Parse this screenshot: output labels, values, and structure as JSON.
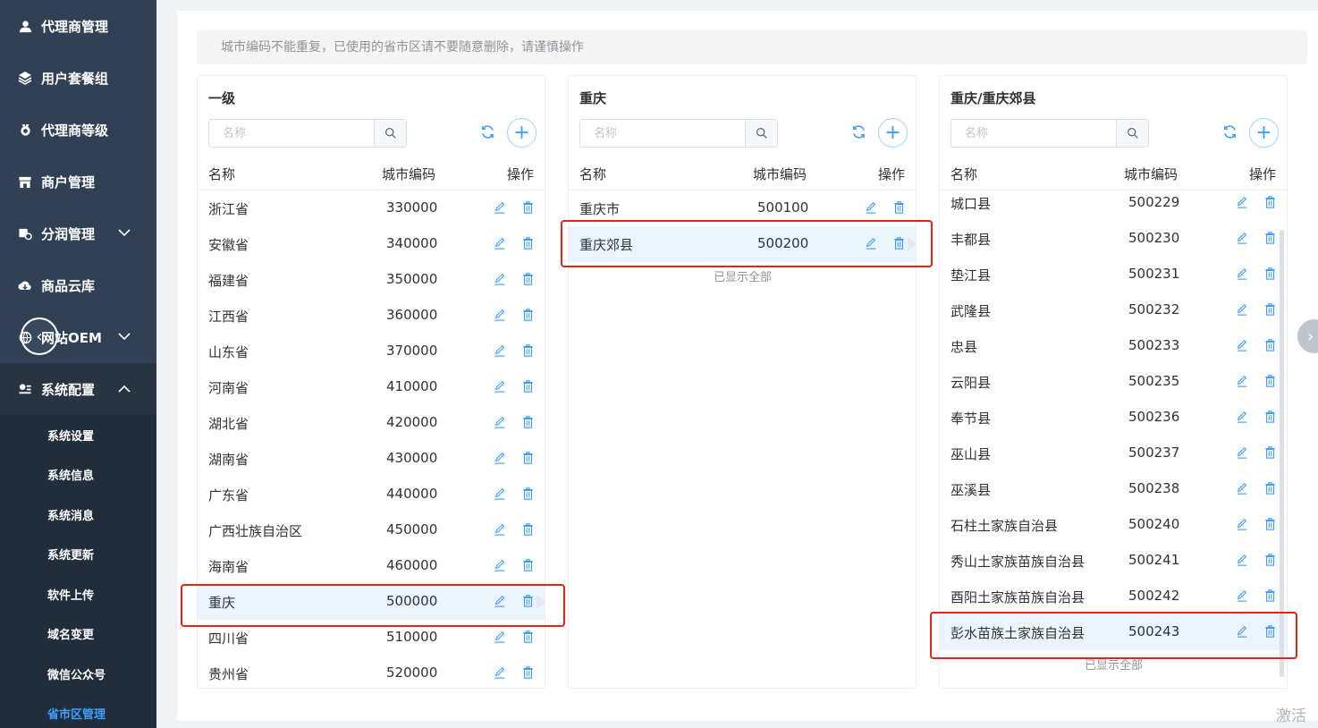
{
  "sidebar": {
    "menu": [
      {
        "label": "代理商管理",
        "icon": "user-icon"
      },
      {
        "label": "用户套餐组",
        "icon": "layers-icon"
      },
      {
        "label": "代理商等级",
        "icon": "medal-icon"
      },
      {
        "label": "商户管理",
        "icon": "shop-icon"
      },
      {
        "label": "分润管理",
        "icon": "split-icon",
        "arrow": "chevron-down-icon"
      },
      {
        "label": "商品云库",
        "icon": "cloud-icon"
      },
      {
        "label": "网站OEM",
        "icon": "globe-icon",
        "arrow": "chevron-down-icon"
      },
      {
        "label": "系统配置",
        "icon": "settings-icon",
        "arrow": "chevron-up-icon"
      }
    ],
    "submenu": [
      {
        "label": "系统设置"
      },
      {
        "label": "系统信息"
      },
      {
        "label": "系统消息"
      },
      {
        "label": "系统更新"
      },
      {
        "label": "软件上传"
      },
      {
        "label": "域名变更"
      },
      {
        "label": "微信公众号"
      },
      {
        "label": "省市区管理",
        "active": true
      }
    ]
  },
  "notice": "城市编码不能重复，已使用的省市区请不要随意删除，请谨慎操作",
  "panels": [
    {
      "title": "一级",
      "search_placeholder": "名称",
      "headers": {
        "name": "名称",
        "code": "城市编码",
        "action": "操作"
      },
      "rows": [
        {
          "name": "浙江省",
          "code": "330000"
        },
        {
          "name": "安徽省",
          "code": "340000"
        },
        {
          "name": "福建省",
          "code": "350000"
        },
        {
          "name": "江西省",
          "code": "360000"
        },
        {
          "name": "山东省",
          "code": "370000"
        },
        {
          "name": "河南省",
          "code": "410000"
        },
        {
          "name": "湖北省",
          "code": "420000"
        },
        {
          "name": "湖南省",
          "code": "430000"
        },
        {
          "name": "广东省",
          "code": "440000"
        },
        {
          "name": "广西壮族自治区",
          "code": "450000"
        },
        {
          "name": "海南省",
          "code": "460000"
        },
        {
          "name": "重庆",
          "code": "500000",
          "selected": true
        },
        {
          "name": "四川省",
          "code": "510000"
        },
        {
          "name": "贵州省",
          "code": "520000"
        }
      ]
    },
    {
      "title": "重庆",
      "search_placeholder": "名称",
      "headers": {
        "name": "名称",
        "code": "城市编码",
        "action": "操作"
      },
      "rows": [
        {
          "name": "重庆市",
          "code": "500100"
        },
        {
          "name": "重庆郊县",
          "code": "500200",
          "selected": true
        }
      ],
      "footer": "已显示全部"
    },
    {
      "title": "重庆/重庆郊县",
      "search_placeholder": "名称",
      "headers": {
        "name": "名称",
        "code": "城市编码",
        "action": "操作"
      },
      "rows": [
        {
          "name": "城口县",
          "code": "500229"
        },
        {
          "name": "丰都县",
          "code": "500230"
        },
        {
          "name": "垫江县",
          "code": "500231"
        },
        {
          "name": "武隆县",
          "code": "500232"
        },
        {
          "name": "忠县",
          "code": "500233"
        },
        {
          "name": "云阳县",
          "code": "500235"
        },
        {
          "name": "奉节县",
          "code": "500236"
        },
        {
          "name": "巫山县",
          "code": "500237"
        },
        {
          "name": "巫溪县",
          "code": "500238"
        },
        {
          "name": "石柱土家族自治县",
          "code": "500240"
        },
        {
          "name": "秀山土家族苗族自治县",
          "code": "500241"
        },
        {
          "name": "酉阳土家族苗族自治县",
          "code": "500242"
        },
        {
          "name": "彭水苗族土家族自治县",
          "code": "500243",
          "selected": true
        }
      ],
      "footer": "已显示全部"
    }
  ],
  "watermark": "激活"
}
